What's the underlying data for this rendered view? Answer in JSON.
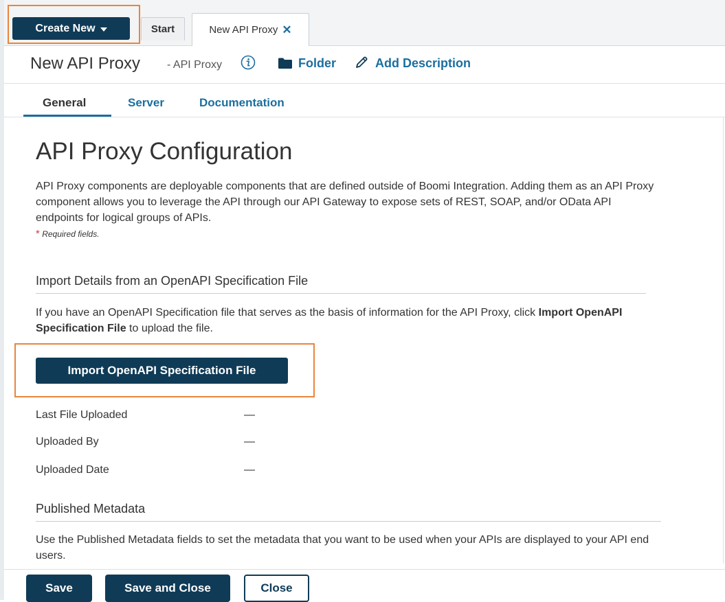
{
  "colors": {
    "primary_button": "#0f3b57",
    "link": "#1b6ea0",
    "highlight_box": "#e8853d",
    "required_star": "#d43b3b"
  },
  "toolbar": {
    "create_new_label": "Create New",
    "create_new_icon": "caret-down-icon"
  },
  "tabs": [
    {
      "label": "Start"
    },
    {
      "label": "New API Proxy",
      "close_icon": "close-icon"
    }
  ],
  "component": {
    "title": "New API Proxy",
    "type_label": "- API Proxy",
    "info_icon": "info-icon",
    "folder_icon": "folder-icon",
    "folder_label": "Folder",
    "pencil_icon": "pencil-icon",
    "add_description_label": "Add Description"
  },
  "subtabs": [
    {
      "label": "General",
      "active": true
    },
    {
      "label": "Server",
      "active": false
    },
    {
      "label": "Documentation",
      "active": false
    }
  ],
  "main": {
    "heading": "API Proxy Configuration",
    "description": "API Proxy components are deployable components that are defined outside of Boomi Integration. Adding them as an API Proxy component allows you to leverage the API through our API Gateway to expose sets of REST, SOAP, and/or OData API endpoints for logical groups of APIs.",
    "required_star": "*",
    "required_text": "Required fields."
  },
  "import_section": {
    "title": "Import Details from an OpenAPI Specification File",
    "desc_before": "If you have an OpenAPI Specification file that serves as the basis of information for the API Proxy, click ",
    "desc_bold": "Import OpenAPI Specification File",
    "desc_after": " to upload the file.",
    "button_label": "Import OpenAPI Specification File",
    "fields": [
      {
        "label": "Last File Uploaded",
        "value": "—"
      },
      {
        "label": "Uploaded By",
        "value": "—"
      },
      {
        "label": "Uploaded Date",
        "value": "—"
      }
    ]
  },
  "metadata_section": {
    "title": "Published Metadata",
    "description": "Use the Published Metadata fields to set the metadata that you want to be used when your APIs are displayed to your API end users."
  },
  "footer": {
    "save_label": "Save",
    "save_close_label": "Save and Close",
    "close_label": "Close"
  }
}
